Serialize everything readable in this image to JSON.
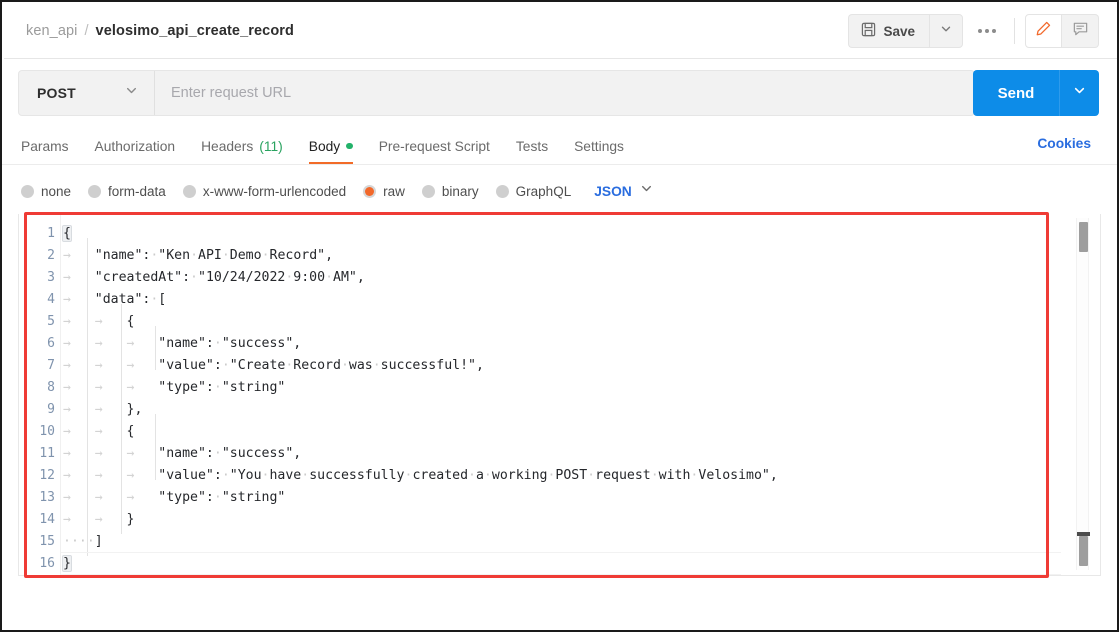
{
  "header": {
    "breadcrumb": {
      "parent": "ken_api",
      "separator": "/",
      "current": "velosimo_api_create_record"
    },
    "save_label": "Save",
    "save_icon": "floppy-disk-icon",
    "save_caret_icon": "chevron-down-icon",
    "more_icon": "ellipsis-icon",
    "edit_icon": "pencil-icon",
    "comment_icon": "comment-icon",
    "accent_orange": "#f26b28"
  },
  "request": {
    "method": "POST",
    "method_caret_icon": "chevron-down-icon",
    "url_placeholder": "Enter request URL",
    "send_label": "Send",
    "send_caret_icon": "chevron-down-icon",
    "send_color": "#0d8ce8"
  },
  "tabs": [
    {
      "label": "Params",
      "active": false
    },
    {
      "label": "Authorization",
      "active": false
    },
    {
      "label": "Headers",
      "count": "(11)",
      "active": false
    },
    {
      "label": "Body",
      "active": true,
      "dot": true
    },
    {
      "label": "Pre-request Script",
      "active": false
    },
    {
      "label": "Tests",
      "active": false
    },
    {
      "label": "Settings",
      "active": false
    }
  ],
  "cookies_label": "Cookies",
  "body_types": [
    {
      "label": "none",
      "selected": false
    },
    {
      "label": "form-data",
      "selected": false
    },
    {
      "label": "x-www-form-urlencoded",
      "selected": false
    },
    {
      "label": "raw",
      "selected": true
    },
    {
      "label": "binary",
      "selected": false
    },
    {
      "label": "GraphQL",
      "selected": false
    }
  ],
  "format_select": {
    "label": "JSON",
    "caret_icon": "chevron-down-icon"
  },
  "editor": {
    "line_numbers": [
      "1",
      "2",
      "3",
      "4",
      "5",
      "6",
      "7",
      "8",
      "9",
      "10",
      "11",
      "12",
      "13",
      "14",
      "15",
      "16"
    ],
    "lines": [
      "{",
      "    \"name\": \"Ken API Demo Record\",",
      "    \"createdAt\": \"10/24/2022 9:00 AM\",",
      "    \"data\": [",
      "        {",
      "            \"name\": \"success\",",
      "            \"value\": \"Create Record was successful!\",",
      "            \"type\": \"string\"",
      "        },",
      "        {",
      "            \"name\": \"success\",",
      "            \"value\": \"You have successfully created a working POST request with Velosimo\",",
      "            \"type\": \"string\"",
      "        }",
      "    ]",
      "}"
    ],
    "whitespace_tab_glyph": "→",
    "whitespace_space_glyph": "·",
    "line_number_color": "#7f93ad",
    "text_color": "#25272b"
  },
  "annotation": {
    "color": "#ef3b35"
  }
}
